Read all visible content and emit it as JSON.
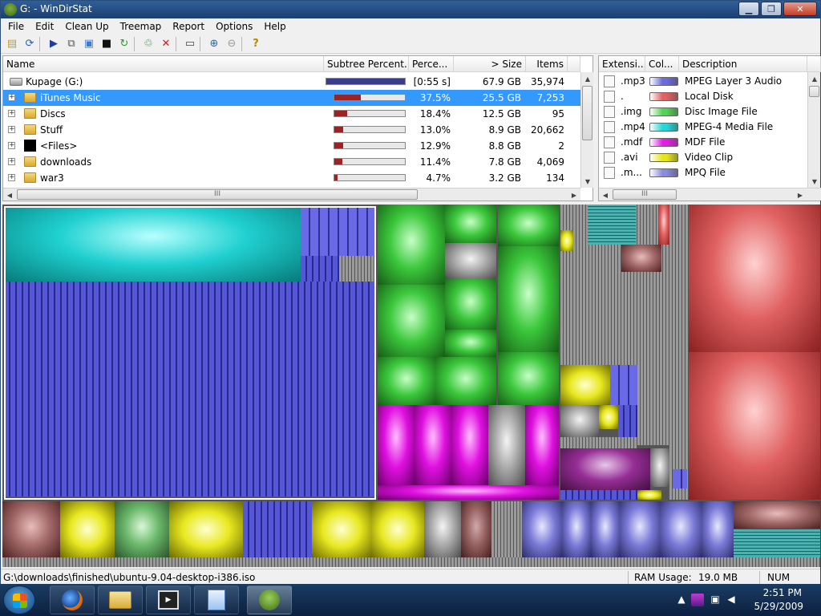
{
  "window": {
    "title": "G: - WinDirStat"
  },
  "menu": [
    "File",
    "Edit",
    "Clean Up",
    "Treemap",
    "Report",
    "Options",
    "Help"
  ],
  "dir_columns": {
    "name": "Name",
    "subtree": "Subtree Percent...",
    "percent": "Perce...",
    "size": "> Size",
    "items": "Items"
  },
  "dir_rows": [
    {
      "name": "Kupage (G:)",
      "pct": "[0:55 s]",
      "size": "67.9 GB",
      "items": "35,974",
      "bar": 1.0,
      "kind": "drive"
    },
    {
      "name": "iTunes Music",
      "pct": "37.5%",
      "size": "25.5 GB",
      "items": "7,253",
      "bar": 0.375,
      "kind": "folder",
      "expander": "+"
    },
    {
      "name": "Discs",
      "pct": "18.4%",
      "size": "12.5 GB",
      "items": "95",
      "bar": 0.184,
      "kind": "folder",
      "expander": "+"
    },
    {
      "name": "Stuff",
      "pct": "13.0%",
      "size": "8.9 GB",
      "items": "20,662",
      "bar": 0.13,
      "kind": "folder",
      "expander": "+"
    },
    {
      "name": "<Files>",
      "pct": "12.9%",
      "size": "8.8 GB",
      "items": "2",
      "bar": 0.129,
      "kind": "files",
      "expander": "+"
    },
    {
      "name": "downloads",
      "pct": "11.4%",
      "size": "7.8 GB",
      "items": "4,069",
      "bar": 0.114,
      "kind": "folder",
      "expander": "+"
    },
    {
      "name": "war3",
      "pct": "4.7%",
      "size": "3.2 GB",
      "items": "134",
      "bar": 0.047,
      "kind": "folder",
      "expander": "+"
    }
  ],
  "ext_columns": {
    "ext": "Extensi...",
    "color": "Col...",
    "desc": "Description"
  },
  "ext_rows": [
    {
      "ext": ".mp3",
      "color": "#6b6bdc",
      "desc": "MPEG Layer 3 Audio"
    },
    {
      "ext": ".",
      "color": "#e06262",
      "desc": "Local Disk"
    },
    {
      "ext": ".img",
      "color": "#52d452",
      "desc": "Disc Image File"
    },
    {
      "ext": ".mp4",
      "color": "#28d6d6",
      "desc": "MPEG-4 Media File"
    },
    {
      "ext": ".mdf",
      "color": "#e51ee5",
      "desc": "MDF File"
    },
    {
      "ext": ".avi",
      "color": "#e6e61e",
      "desc": "Video Clip"
    },
    {
      "ext": ".m...",
      "color": "#8a8ae0",
      "desc": "MPQ File"
    }
  ],
  "status": {
    "path": "G:\\downloads\\finished\\ubuntu-9.04-desktop-i386.iso",
    "ram_label": "RAM Usage:",
    "ram_value": "19.0 MB",
    "num": "NUM"
  },
  "clock": {
    "time": "2:51 PM",
    "date": "5/29/2009"
  },
  "scroll_glyph": "III"
}
